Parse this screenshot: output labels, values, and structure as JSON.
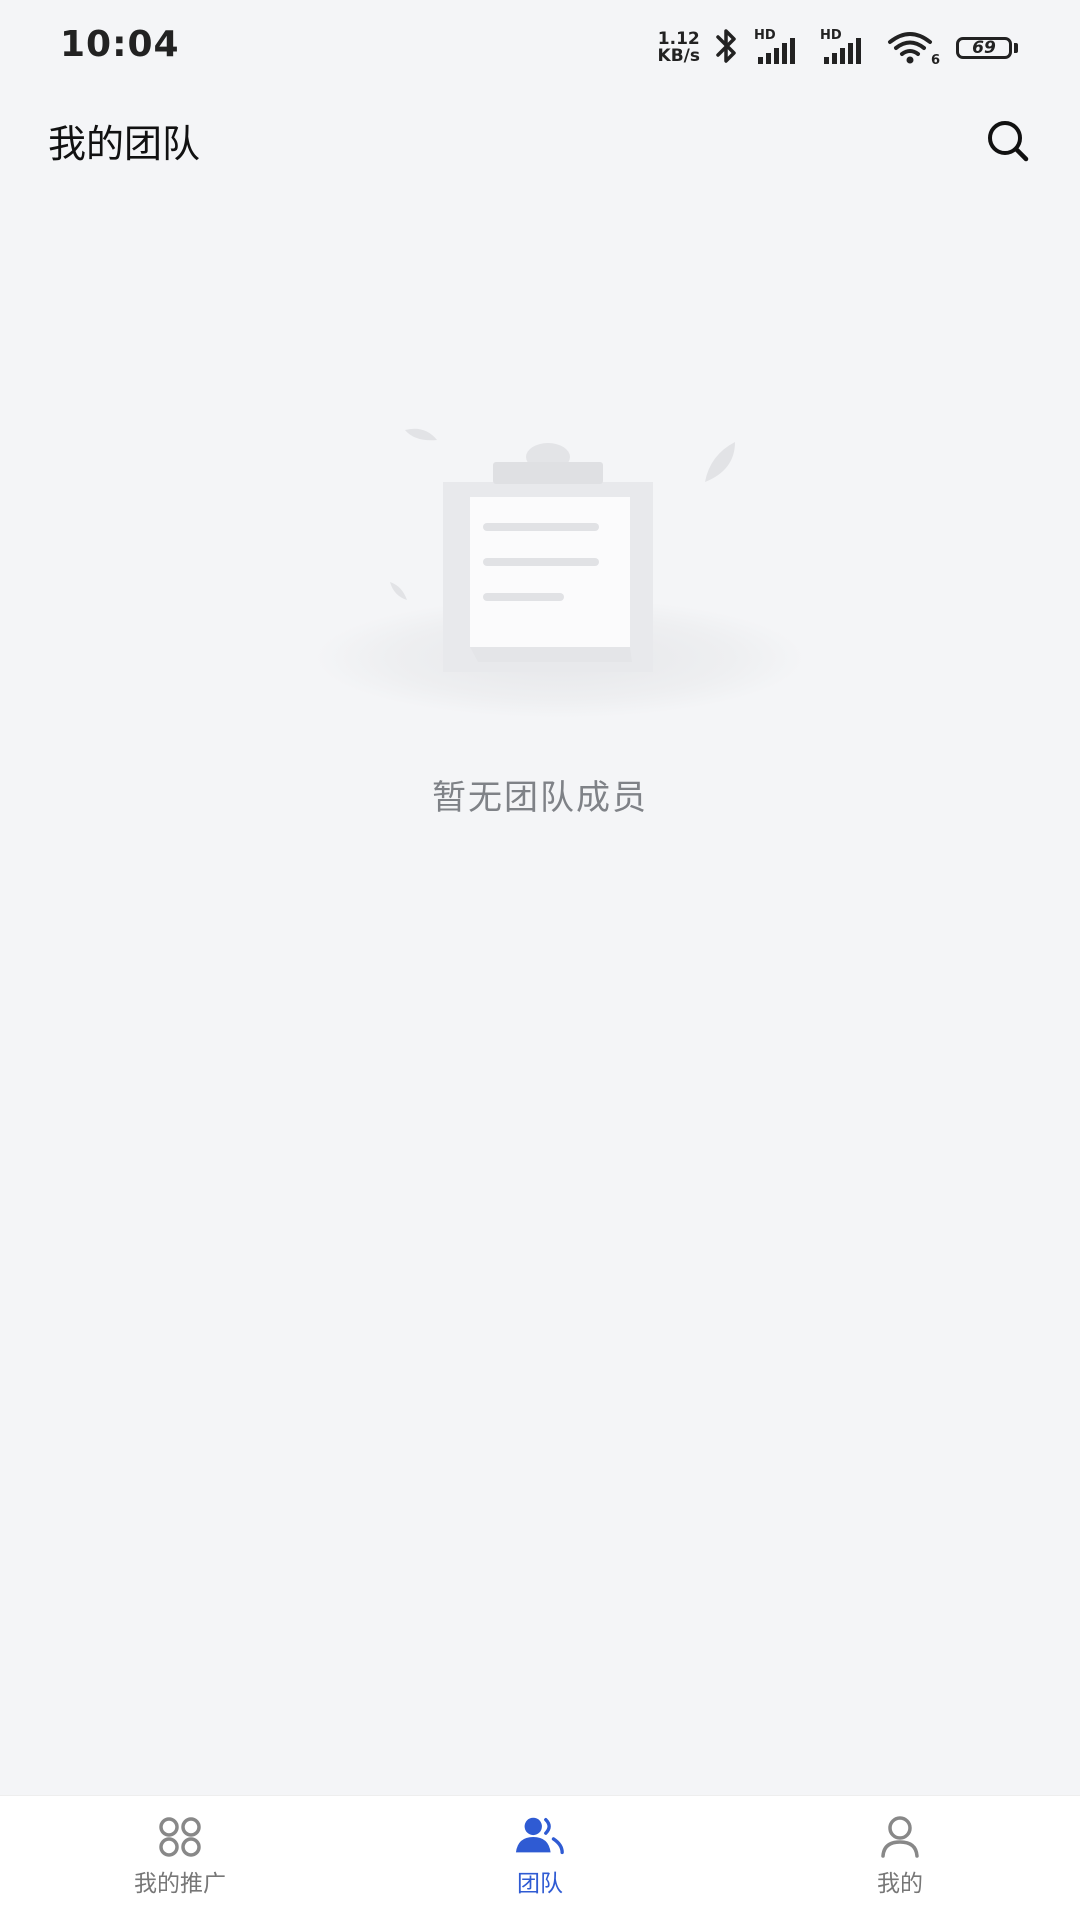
{
  "status_bar": {
    "time": "10:04",
    "net_speed_value": "1.12",
    "net_speed_unit": "KB/s",
    "sim1_label": "HD",
    "sim2_label": "HD",
    "wifi_label": "6",
    "battery": "69"
  },
  "header": {
    "title": "我的团队",
    "search_icon": "search-icon"
  },
  "empty_state": {
    "illustration_icon": "empty-clipboard-icon",
    "message": "暂无团队成员"
  },
  "bottom_nav": {
    "items": [
      {
        "label": "我的推广",
        "icon": "grid-icon",
        "active": false
      },
      {
        "label": "团队",
        "icon": "team-icon",
        "active": true
      },
      {
        "label": "我的",
        "icon": "user-icon",
        "active": false
      }
    ]
  },
  "colors": {
    "background": "#f4f5f7",
    "accent": "#2f5bd3",
    "inactive": "#777777"
  }
}
